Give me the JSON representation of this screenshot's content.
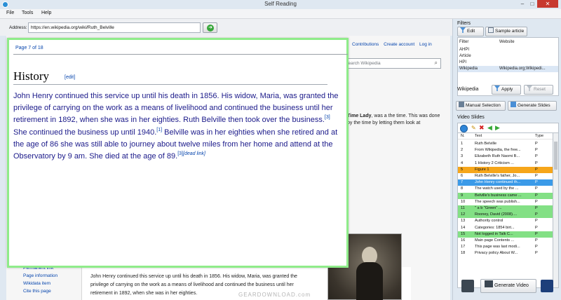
{
  "window": {
    "title": "Self Reading",
    "min": "–",
    "max": "□",
    "close": "✕"
  },
  "menu": [
    "File",
    "Tools",
    "Help"
  ],
  "address": {
    "label": "Address:",
    "value": "https://en.wikipedia.org/wiki/Ruth_Belville"
  },
  "webpage": {
    "top_links": [
      "Contributions",
      "Create account",
      "Log in"
    ],
    "search_placeholder": "Search Wikipedia",
    "snippet_bold": "Time Lady",
    "snippet_rest": ", was a the time. This was done by the time by letting them look at",
    "sidebar_links": [
      "Permanent link",
      "Page information",
      "Wikidata item",
      "Cite this page"
    ],
    "main_text": "John Henry continued this service up until his death in 1856. His widow, Maria, was granted the privilege of carrying on the work as a means of livelihood and continued the business until her retirement in 1892, when she was in her eighties."
  },
  "overlay": {
    "page_indicator": "Page 7 of 18",
    "heading": "History",
    "edit_link": "[edit]",
    "body_1": "John Henry continued this service up until his death in 1856. His widow, Maria, was granted the privilege of carrying on the work as a means of livelihood and continued the business until her retirement in 1892, when she was in her eighties. Ruth Belville then took over the business.",
    "ref_1": "[3]",
    "body_2": " She continued the business up until 1940.",
    "ref_2": "[1]",
    "body_3": " Belville was in her eighties when she retired and at the age of 86 she was still able to journey about twelve miles from her home and attend at the Observatory by 9 am. She died at the age of 89.",
    "ref_3": "[3]",
    "dead_link": "[dead link]"
  },
  "filters": {
    "title": "Filters",
    "edit_label": "Edit",
    "sample_label": "Sample article",
    "columns": [
      "Filter",
      "Website"
    ],
    "rows": [
      {
        "filter": "AHPI",
        "website": ""
      },
      {
        "filter": "Article",
        "website": ""
      },
      {
        "filter": "HPI",
        "website": ""
      },
      {
        "filter": "Wikipedia",
        "website": "Wikipedia.org;Wikipedi..."
      }
    ],
    "selected_filter": "Wikipedia",
    "apply_label": "Apply",
    "reset_label": "Reset"
  },
  "actions": {
    "manual_selection": "Manual Selection",
    "generate_slides": "Generate Slides"
  },
  "slides": {
    "title": "Video Slides",
    "columns": [
      "N.",
      "Text",
      "Type"
    ],
    "rows": [
      {
        "n": "1",
        "text": "Ruth Belville",
        "type": "P",
        "hl": ""
      },
      {
        "n": "2",
        "text": "From Wikipedia, the free...",
        "type": "P",
        "hl": ""
      },
      {
        "n": "3",
        "text": "Elizabeth Ruth Naomi B...",
        "type": "P",
        "hl": ""
      },
      {
        "n": "4",
        "text": "1 History   2 Criticism ...",
        "type": "P",
        "hl": ""
      },
      {
        "n": "5",
        "text": "Figure 1",
        "type": "P",
        "hl": "orange"
      },
      {
        "n": "6",
        "text": "Ruth Belville's father, Jo...",
        "type": "P",
        "hl": ""
      },
      {
        "n": "7",
        "text": "John Henry continued th...",
        "type": "P",
        "hl": "blue"
      },
      {
        "n": "8",
        "text": "The watch used by the ...",
        "type": "P",
        "hl": ""
      },
      {
        "n": "9",
        "text": "Belville's business came ...",
        "type": "P",
        "hl": "green"
      },
      {
        "n": "10",
        "text": "The speech was publish...",
        "type": "P",
        "hl": ""
      },
      {
        "n": "11",
        "text": "\"  a   b  \"Green\"  ...",
        "type": "P",
        "hl": "green"
      },
      {
        "n": "12",
        "text": "Rooney, David (2008)....",
        "type": "P",
        "hl": "green"
      },
      {
        "n": "13",
        "text": "Authority control",
        "type": "P",
        "hl": ""
      },
      {
        "n": "14",
        "text": "Categories:   1854 birt...",
        "type": "P",
        "hl": ""
      },
      {
        "n": "15",
        "text": "Not logged in   Talk  C...",
        "type": "P",
        "hl": "green"
      },
      {
        "n": "16",
        "text": "Main page  Contents ...",
        "type": "P",
        "hl": ""
      },
      {
        "n": "17",
        "text": "This page was last modi...",
        "type": "P",
        "hl": ""
      },
      {
        "n": "18",
        "text": "Privacy policy   About W...",
        "type": "P",
        "hl": ""
      }
    ]
  },
  "generate_video": "Generate Video",
  "watermark": "GEARDOWNLOAD.com",
  "colors": {
    "overlay_border": "#8fec8a",
    "row_green": "#83e085",
    "row_orange": "#f6a61a",
    "row_blue": "#3b9ae8"
  }
}
